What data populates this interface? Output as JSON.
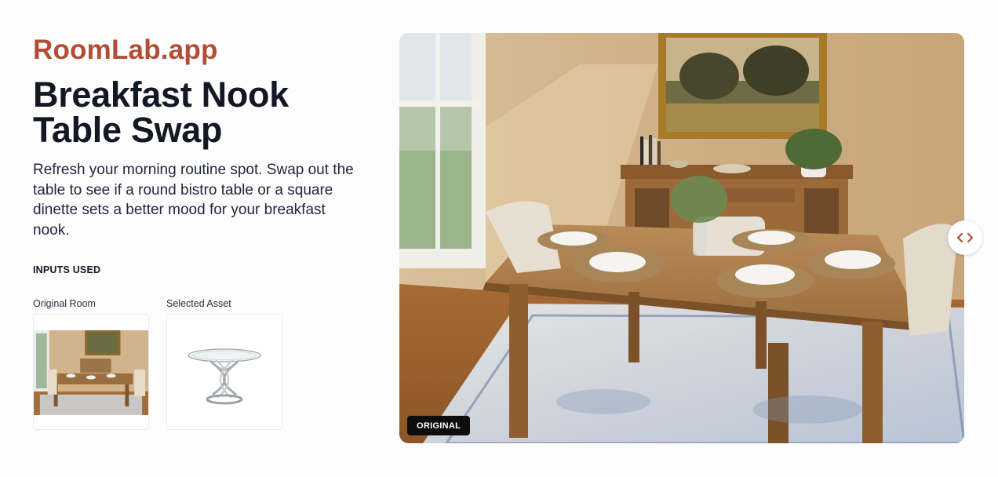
{
  "brand": {
    "name": "RoomLab.app"
  },
  "hero": {
    "title": "Breakfast Nook Table Swap",
    "description": "Refresh your morning routine spot. Swap out the table to see if a round bistro table or a square dinette sets a better mood for your breakfast nook."
  },
  "inputs": {
    "heading": "INPUTS USED",
    "original_room": {
      "caption": "Original Room"
    },
    "selected_asset": {
      "caption": "Selected Asset"
    }
  },
  "preview": {
    "badge": "ORIGINAL",
    "slider_icon": "chevron-left-right-icon"
  },
  "colors": {
    "brand": "#b24e36",
    "heading": "#141824",
    "badge_bg": "#0d0d0d"
  }
}
